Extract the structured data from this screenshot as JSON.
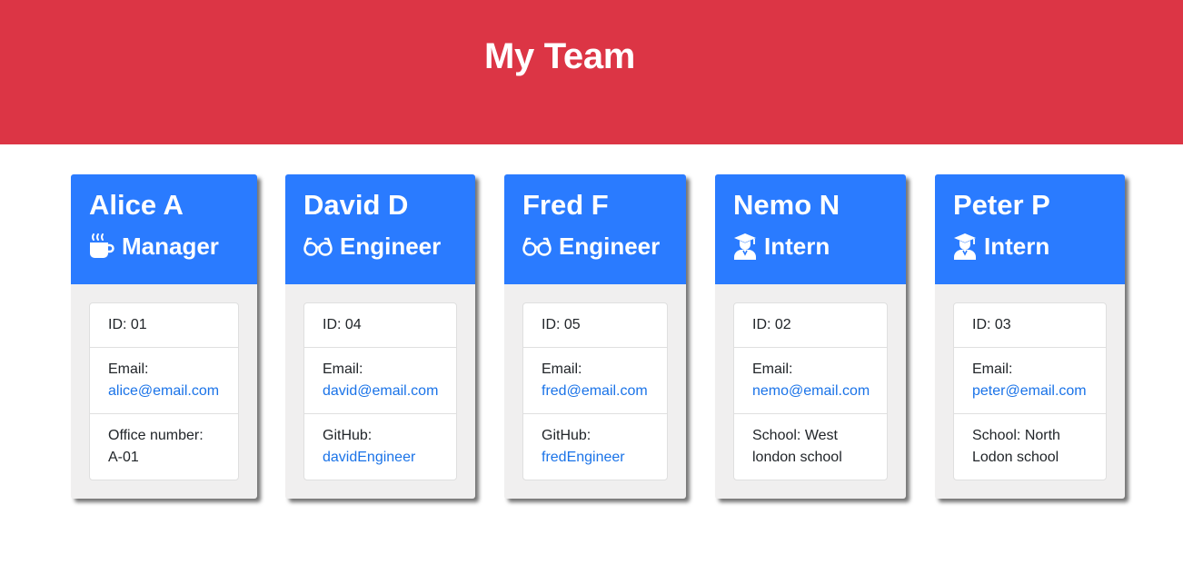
{
  "header": {
    "title": "My Team"
  },
  "colors": {
    "header_bg": "#dc3545",
    "card_head_bg": "#2a7bff",
    "link": "#1a73e8"
  },
  "team": [
    {
      "name": "Alice A",
      "role": "Manager",
      "icon": "coffee-icon",
      "id": "ID: 01",
      "email_label": "Email:",
      "email": "alice@email.com",
      "extra_label": "Office number:",
      "extra_value": "A-01"
    },
    {
      "name": "David D",
      "role": "Engineer",
      "icon": "glasses-icon",
      "id": "ID: 04",
      "email_label": "Email:",
      "email": "david@email.com",
      "extra_label": "GitHub:",
      "extra_value": "davidEngineer"
    },
    {
      "name": "Fred F",
      "role": "Engineer",
      "icon": "glasses-icon",
      "id": "ID: 05",
      "email_label": "Email:",
      "email": "fred@email.com",
      "extra_label": "GitHub:",
      "extra_value": "fredEngineer"
    },
    {
      "name": "Nemo N",
      "role": "Intern",
      "icon": "graduate-icon",
      "id": "ID: 02",
      "email_label": "Email:",
      "email": "nemo@email.com",
      "extra_label": "School: West london school",
      "extra_value": ""
    },
    {
      "name": "Peter P",
      "role": "Intern",
      "icon": "graduate-icon",
      "id": "ID: 03",
      "email_label": "Email:",
      "email": "peter@email.com",
      "extra_label": "School: North Lodon school",
      "extra_value": ""
    }
  ]
}
